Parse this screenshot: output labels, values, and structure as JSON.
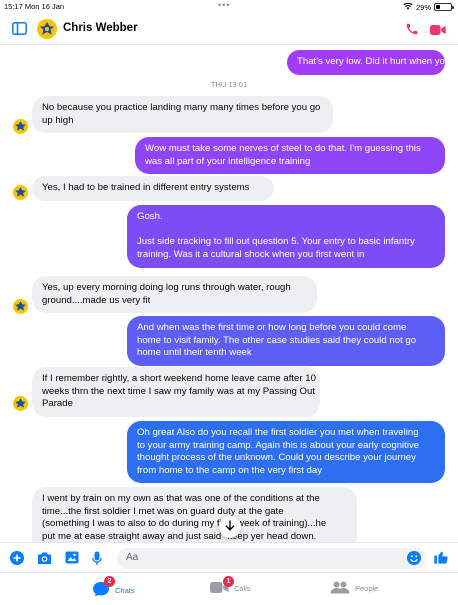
{
  "status_bar": {
    "time_date": "15:17  Mon 16 Jan",
    "battery": "29%",
    "battery_level": 0.29
  },
  "header": {
    "contact_name": "Chris Webber"
  },
  "conversation": {
    "timestamp": "THU 13:01",
    "messages": [
      {
        "direction": "out",
        "lines": [
          "That's very low. Did it hurt when you land"
        ]
      },
      {
        "direction": "in",
        "lines": [
          "No because you practice landing many many times before you go",
          "up high"
        ]
      },
      {
        "direction": "out",
        "lines": [
          "Wow must take some nerves of steel to do that. I'm guessing this",
          "was all part of your intelligence training"
        ]
      },
      {
        "direction": "in",
        "lines": [
          "Yes, I had to be trained in different entry systems"
        ]
      },
      {
        "direction": "out",
        "lines": [
          "Gosh.",
          "",
          "Just side tracking to fill out question 5. Your entry to basic infantry",
          "training. Was it a cultural shock when you first went in"
        ]
      },
      {
        "direction": "in",
        "lines": [
          "Yes, up every morning doing log runs through water, rough",
          "ground....made us very fit"
        ]
      },
      {
        "direction": "out",
        "lines": [
          "And when was the first time or how long before you could come",
          "home to visit family. The other case studies said they could not go",
          "home until their tenth week"
        ]
      },
      {
        "direction": "in",
        "lines": [
          "If I remember rightly, a short weekend home leave came after 10",
          "weeks thrn the next time I saw my family was at my Passing Out",
          "Parade"
        ]
      },
      {
        "direction": "out",
        "lines": [
          "Oh great Also do you recall the first soldier you met when traveling",
          "to your army training camp. Again this is about your early cognitive",
          "thought process of the unknown. Could you describe your journey",
          "from home to the camp on the very first day"
        ]
      },
      {
        "direction": "in",
        "lines": [
          "I went by train on my own as that was one of the conditions at the",
          "time...the first soldier I met was on guard duty at the gate",
          "(something I was to also to do during my final week of training)...he",
          "put me at ease straight away and just said \"keep yer head down."
        ]
      }
    ]
  },
  "composer": {
    "placeholder": "Aa"
  },
  "tabs": [
    {
      "label": "Chats",
      "badge": "2",
      "active": true
    },
    {
      "label": "Calls",
      "badge": "1",
      "active": false
    },
    {
      "label": "People",
      "badge": "",
      "active": false
    }
  ],
  "colors": {
    "accent": "#0a7cff",
    "bubble_pink": "#a033ff",
    "bubble_blue": "#2e6ef0",
    "incoming_bg": "#eeeff1",
    "badge": "#f02849"
  }
}
